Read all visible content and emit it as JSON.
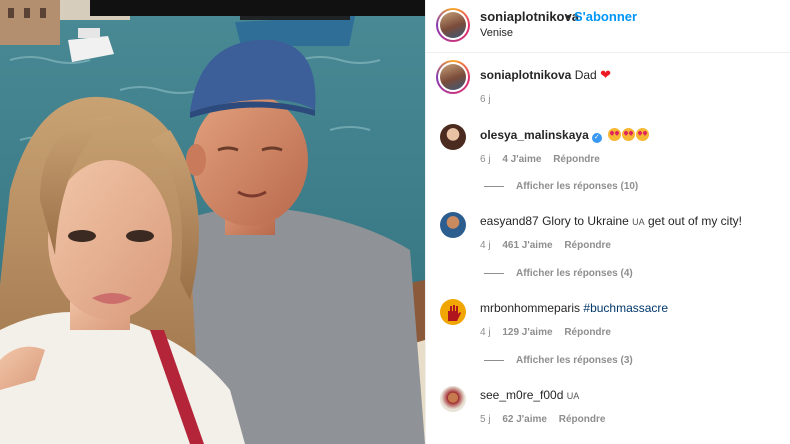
{
  "post": {
    "username": "soniaplotnikova",
    "separator": "•",
    "follow_label": "S'abonner",
    "location": "Venise"
  },
  "caption": {
    "username": "soniaplotnikova",
    "text": "Dad",
    "emoji": "red-heart",
    "time": "6 j"
  },
  "comments": [
    {
      "username": "olesya_malinskaya",
      "verified": true,
      "text": "",
      "emoji": "heart-eyes x3",
      "time": "6 j",
      "likes": "4 J'aime",
      "reply_label": "Répondre",
      "view_replies": "Afficher les réponses (10)"
    },
    {
      "username": "easyand87",
      "text_before": "Glory to Ukraine",
      "flag": "UA",
      "text_after": "get out of my city!",
      "time": "4 j",
      "likes": "461 J'aime",
      "reply_label": "Répondre",
      "view_replies": "Afficher les réponses (4)"
    },
    {
      "username": "mrbonhommeparis",
      "text": "#buchmassacre",
      "time": "4 j",
      "likes": "129 J'aime",
      "reply_label": "Répondre",
      "view_replies": "Afficher les réponses (3)"
    },
    {
      "username": "see_m0re_f00d",
      "flag": "UA",
      "text": "",
      "time": "5 j",
      "likes": "62 J'aime",
      "reply_label": "Répondre"
    }
  ],
  "colors": {
    "link_blue": "#0095f6",
    "meta_gray": "#8e8e8e",
    "heart_red": "#ed1c24",
    "hashtag_blue": "#00376b"
  }
}
